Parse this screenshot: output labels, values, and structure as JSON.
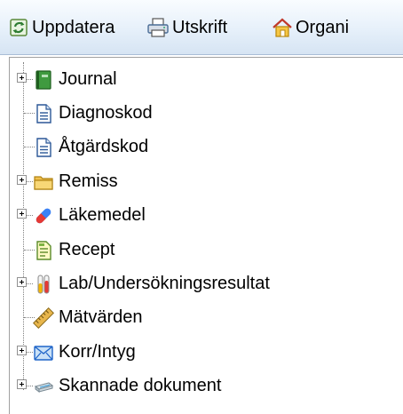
{
  "toolbar": {
    "items": [
      {
        "label": "Uppdatera",
        "icon": "refresh-icon"
      },
      {
        "label": "Utskrift",
        "icon": "printer-icon"
      },
      {
        "label": "Organi",
        "icon": "home-icon"
      }
    ]
  },
  "tree": {
    "items": [
      {
        "label": "Journal",
        "icon": "green-book-icon",
        "expandable": true
      },
      {
        "label": "Diagnoskod",
        "icon": "document-icon",
        "expandable": false
      },
      {
        "label": "Åtgärdskod",
        "icon": "document-icon",
        "expandable": false
      },
      {
        "label": "Remiss",
        "icon": "folder-icon",
        "expandable": true
      },
      {
        "label": "Läkemedel",
        "icon": "pill-icon",
        "expandable": true
      },
      {
        "label": "Recept",
        "icon": "prescription-icon",
        "expandable": false
      },
      {
        "label": "Lab/Undersökningsresultat",
        "icon": "test-tubes-icon",
        "expandable": true
      },
      {
        "label": "Mätvärden",
        "icon": "ruler-icon",
        "expandable": false
      },
      {
        "label": "Korr/Intyg",
        "icon": "envelope-icon",
        "expandable": true
      },
      {
        "label": "Skannade dokument",
        "icon": "scanner-icon",
        "expandable": true
      }
    ]
  }
}
